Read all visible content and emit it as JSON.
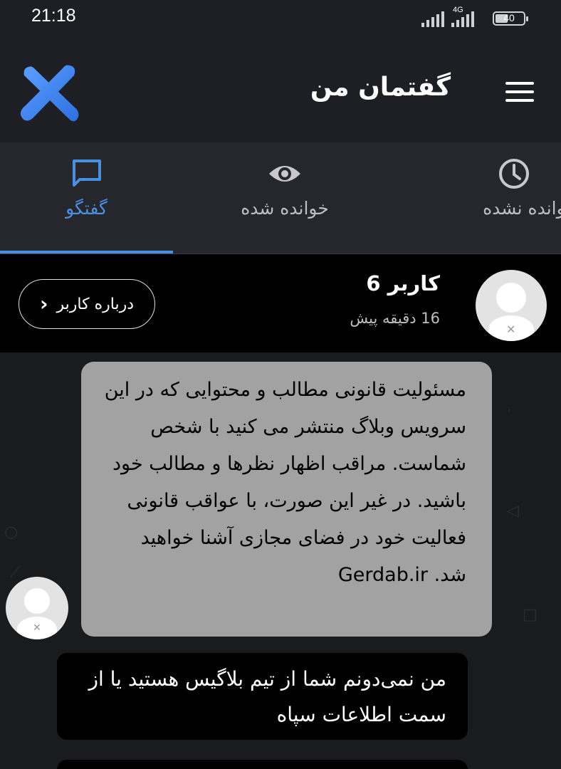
{
  "status_bar": {
    "time": "21:18",
    "network": "4G",
    "battery": "40"
  },
  "app_bar": {
    "title": "گفتمان من",
    "logo_icon": "x-logo-icon",
    "menu_icon": "hamburger-menu-icon"
  },
  "tabs": [
    {
      "label": "گفتگو",
      "icon": "chat-icon",
      "active": true
    },
    {
      "label": "خوانده شده",
      "icon": "eye-icon",
      "active": false
    },
    {
      "label": "خوانده نشده",
      "icon": "clock-icon",
      "active": false
    }
  ],
  "user_header": {
    "name": "کاربر 6",
    "time": "16 دقیقه پیش",
    "about_button": "درباره کاربر"
  },
  "messages": [
    {
      "direction": "incoming",
      "text": "مسئولیت قانونی مطالب و محتوایی که در این سرویس وبلاگ منتشر می کنید با شخص شماست. مراقب اظهار نظرها و مطالب خود باشید. در غیر این صورت، با عواقب قانونی فعالیت خود در فضای مجازی آشنا خواهید شد. Gerdab.ir"
    },
    {
      "direction": "outgoing",
      "text": "من نمی‌دونم شما از تیم بلاگیس هستید یا از سمت اطلاعات سپاه"
    }
  ],
  "colors": {
    "accent": "#4a90e2",
    "appbar_bg": "#1e1f24",
    "tabs_bg": "#25272d",
    "incoming_bubble": "#a2a2a2",
    "outgoing_bubble": "#000000"
  }
}
